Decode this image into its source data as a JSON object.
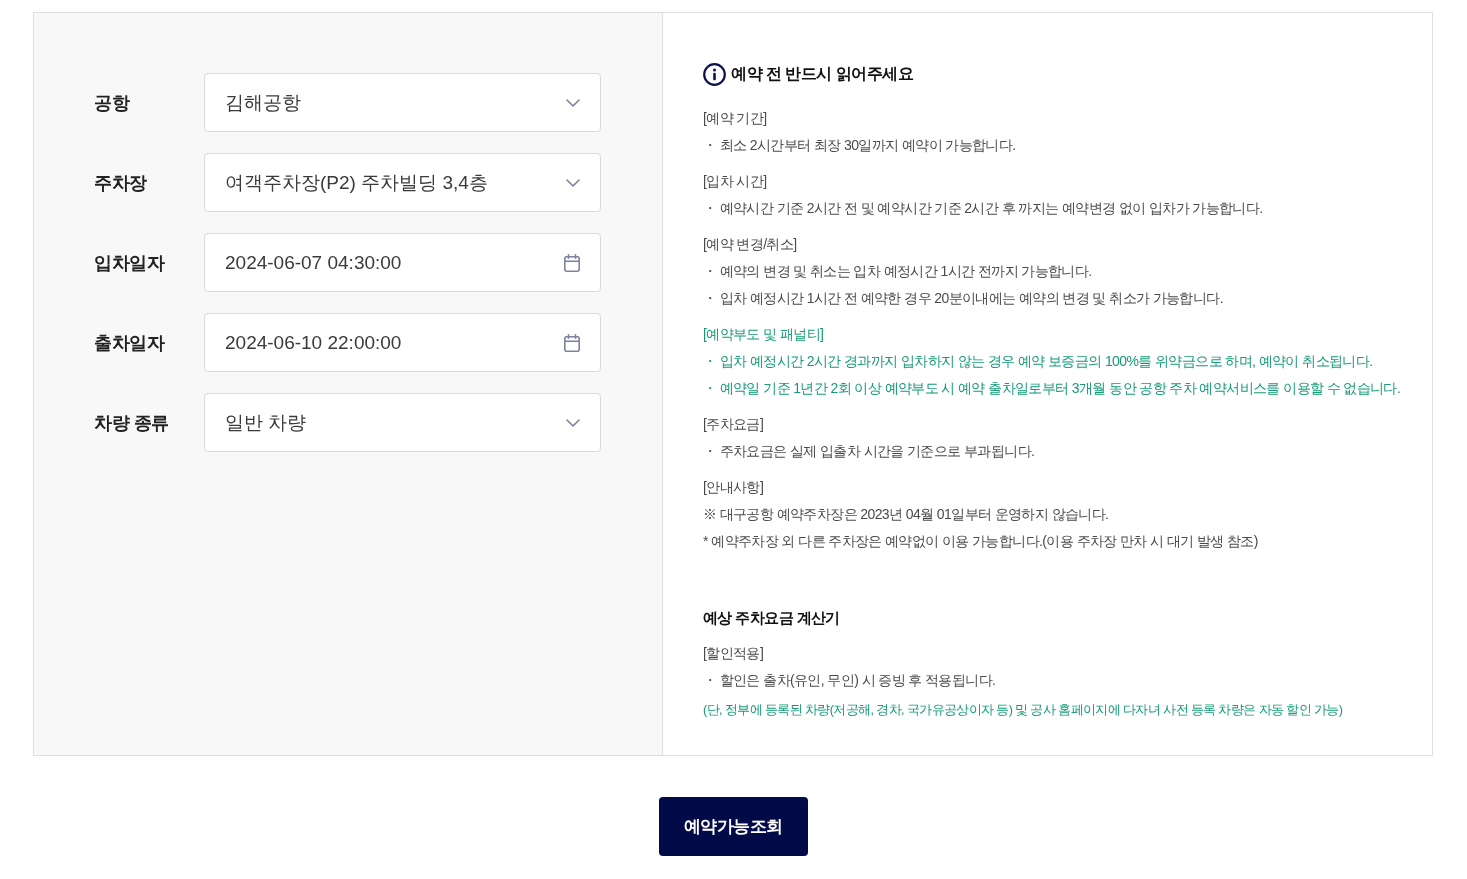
{
  "form": {
    "fields": [
      {
        "label": "공항",
        "kind": "select",
        "value": "김해공항"
      },
      {
        "label": "주차장",
        "kind": "select",
        "value": "여객주차장(P2) 주차빌딩 3,4층"
      },
      {
        "label": "입차일자",
        "kind": "date",
        "value": "2024-06-07 04:30:00"
      },
      {
        "label": "출차일자",
        "kind": "date",
        "value": "2024-06-10 22:00:00"
      },
      {
        "label": "차량 종류",
        "kind": "select",
        "value": "일반 차량"
      }
    ]
  },
  "notice": {
    "title": "예약 전 반드시 읽어주세요",
    "sections": [
      {
        "heading": "[예약 기간]",
        "highlighted": false,
        "lines": [
          "・ 최소 2시간부터 최장 30일까지 예약이 가능합니다."
        ]
      },
      {
        "heading": "[입차 시간]",
        "highlighted": false,
        "lines": [
          "・ 예약시간 기준 2시간 전 및 예약시간 기준 2시간 후 까지는 예약변경 없이 입차가 가능합니다."
        ]
      },
      {
        "heading": "[예약 변경/취소]",
        "highlighted": false,
        "lines": [
          "・ 예약의 변경 및 취소는 입차 예정시간 1시간 전까지 가능합니다.",
          "・ 입차 예정시간 1시간 전 예약한 경우 20분이내에는 예약의 변경 및 취소가 가능합니다."
        ]
      },
      {
        "heading": "[예약부도 및 패널티]",
        "highlighted": true,
        "lines": [
          "・ 입차 예정시간 2시간 경과까지 입차하지 않는 경우 예약 보증금의 100%를 위약금으로 하며, 예약이 취소됩니다.",
          "・ 예약일 기준 1년간 2회 이상 예약부도 시 예약 출차일로부터 3개월 동안 공항 주차 예약서비스를 이용할 수 없습니다."
        ]
      },
      {
        "heading": "[주차요금]",
        "highlighted": false,
        "lines": [
          "・ 주차요금은 실제 입출차 시간을 기준으로 부과됩니다."
        ]
      },
      {
        "heading": "[안내사항]",
        "highlighted": false,
        "lines": [
          "※ 대구공항 예약주차장은 2023년 04월 01일부터 운영하지 않습니다.",
          "* 예약주차장 외 다른 주차장은 예약없이 이용 가능합니다.(이용 주차장 만차 시 대기 발생 참조)"
        ]
      }
    ]
  },
  "calculator": {
    "title": "예상 주차요금 계산기",
    "sections": [
      {
        "heading": "[할인적용]",
        "highlighted": false,
        "lines": [
          "・ 할인은 출차(유인, 무인) 시 증빙 후 적용됩니다."
        ]
      }
    ],
    "footnote": "(단, 정부에 등록된 차량(저공해, 경차, 국가유공상이자 등) 및 공사 홈페이지에 다자녀 사전 등록 차량은 자동 할인 가능)"
  },
  "search_button": "예약가능조회"
}
